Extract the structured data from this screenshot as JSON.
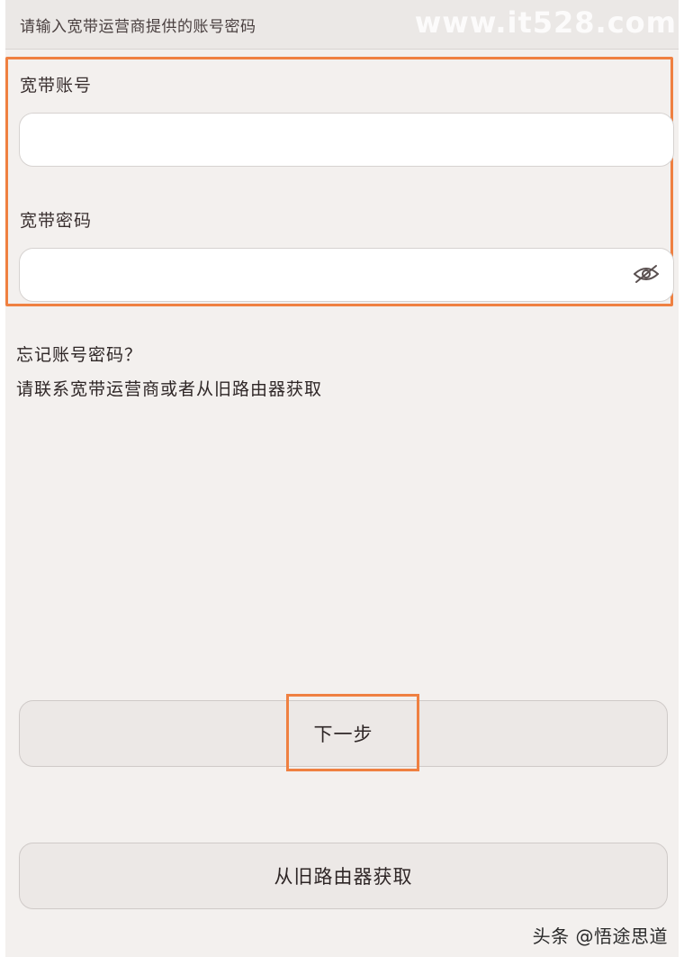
{
  "header": {
    "instruction": "请输入宽带运营商提供的账号密码",
    "watermark": "www.it528.com"
  },
  "form": {
    "account_label": "宽带账号",
    "account_value": "",
    "account_placeholder": "",
    "password_label": "宽带密码",
    "password_value": "",
    "password_placeholder": "",
    "visibility_icon": "eye-hidden-icon"
  },
  "help": {
    "title": "忘记账号密码？",
    "text": "请联系宽带运营商或者从旧路由器获取"
  },
  "buttons": {
    "next_label": "下一步",
    "old_router_label": "从旧路由器获取"
  },
  "footer": {
    "watermark": "头条 @悟途思道"
  },
  "colors": {
    "highlight": "#ef8041",
    "background": "#f3f0ee"
  }
}
